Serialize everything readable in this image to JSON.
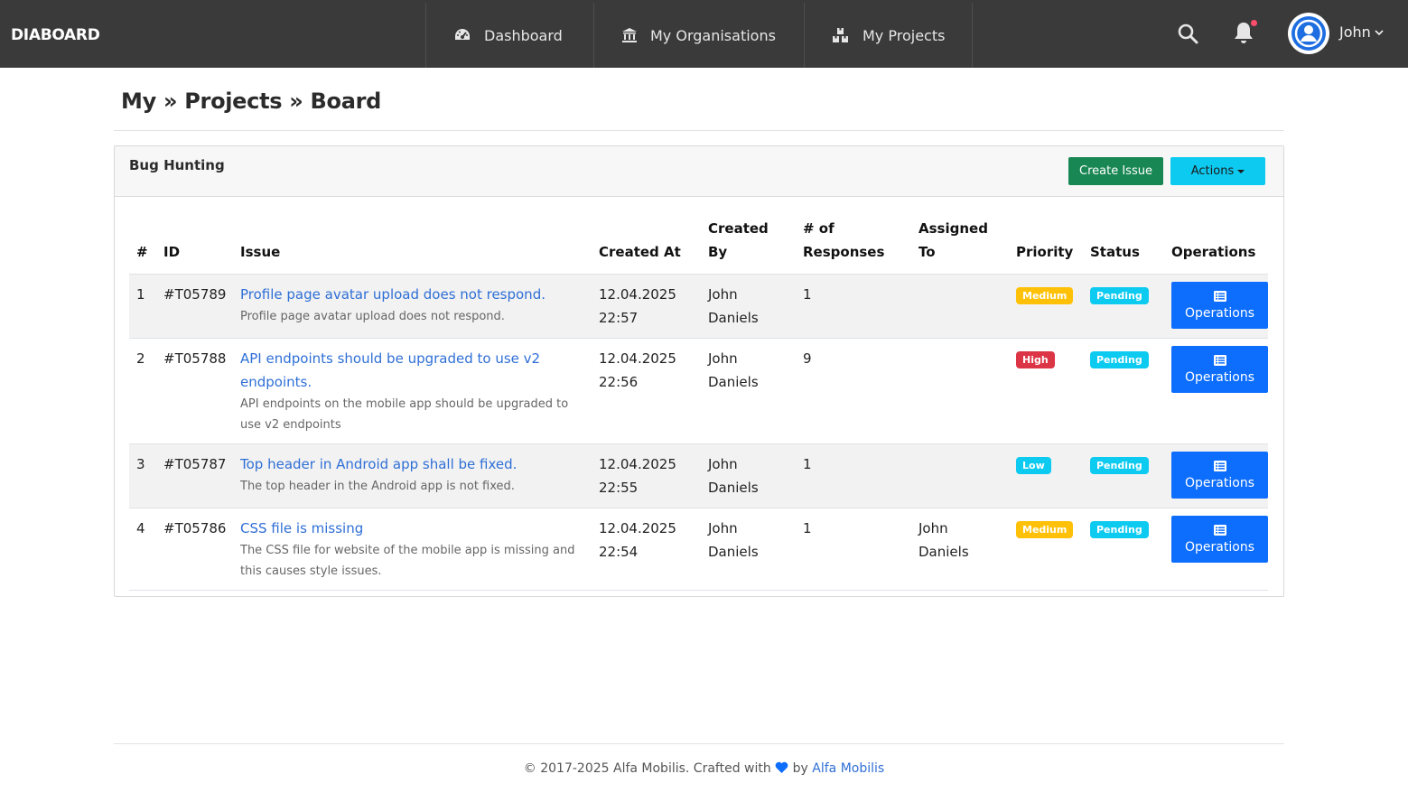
{
  "brand": "DIABOARD",
  "nav": [
    {
      "label": "Dashboard",
      "icon": "gauge-icon"
    },
    {
      "label": "My Organisations",
      "icon": "bank-icon"
    },
    {
      "label": "My Projects",
      "icon": "boxes-icon"
    }
  ],
  "user": {
    "name": "John"
  },
  "page_title": "My » Projects » Board",
  "card": {
    "title": "Bug Hunting",
    "create_label": "Create Issue",
    "actions_label": "Actions"
  },
  "table": {
    "headers": {
      "num": "#",
      "id": "ID",
      "issue": "Issue",
      "created_at": "Created At",
      "created_by": "Created By",
      "responses": "# of Responses",
      "assigned_to": "Assigned To",
      "priority": "Priority",
      "status": "Status",
      "operations": "Operations"
    },
    "rows": [
      {
        "num": "1",
        "id": "#T05789",
        "title": "Profile page avatar upload does not respond.",
        "desc": "Profile page avatar upload does not respond.",
        "created_at": "12.04.2025 22:57",
        "created_by": "John Daniels",
        "responses": "1",
        "assigned_to": "",
        "priority": "Medium",
        "status": "Pending",
        "op_label": "Operations"
      },
      {
        "num": "2",
        "id": "#T05788",
        "title": "API endpoints should be upgraded to use v2 endpoints.",
        "desc": "API endpoints on the mobile app should be upgraded to use v2 endpoints",
        "created_at": "12.04.2025 22:56",
        "created_by": "John Daniels",
        "responses": "9",
        "assigned_to": "",
        "priority": "High",
        "status": "Pending",
        "op_label": "Operations"
      },
      {
        "num": "3",
        "id": "#T05787",
        "title": "Top header in Android app shall be fixed.",
        "desc": "The top header in the Android app is not fixed.",
        "created_at": "12.04.2025 22:55",
        "created_by": "John Daniels",
        "responses": "1",
        "assigned_to": "",
        "priority": "Low",
        "status": "Pending",
        "op_label": "Operations"
      },
      {
        "num": "4",
        "id": "#T05786",
        "title": "CSS file is missing",
        "desc": "The CSS file for website of the mobile app is missing and this causes style issues.",
        "created_at": "12.04.2025 22:54",
        "created_by": "John Daniels",
        "responses": "1",
        "assigned_to": "John Daniels",
        "priority": "Medium",
        "status": "Pending",
        "op_label": "Operations"
      }
    ]
  },
  "footer": {
    "prefix": "© 2017-2025 Alfa Mobilis. Crafted with",
    "by": "by",
    "link": "Alfa Mobilis"
  },
  "colors": {
    "navbar": "#3a3a3a",
    "primary": "#0d6efd",
    "success": "#198754",
    "info": "#0dcaf0",
    "warning": "#ffc107",
    "danger": "#dc3545",
    "link": "#2f6fd6"
  }
}
